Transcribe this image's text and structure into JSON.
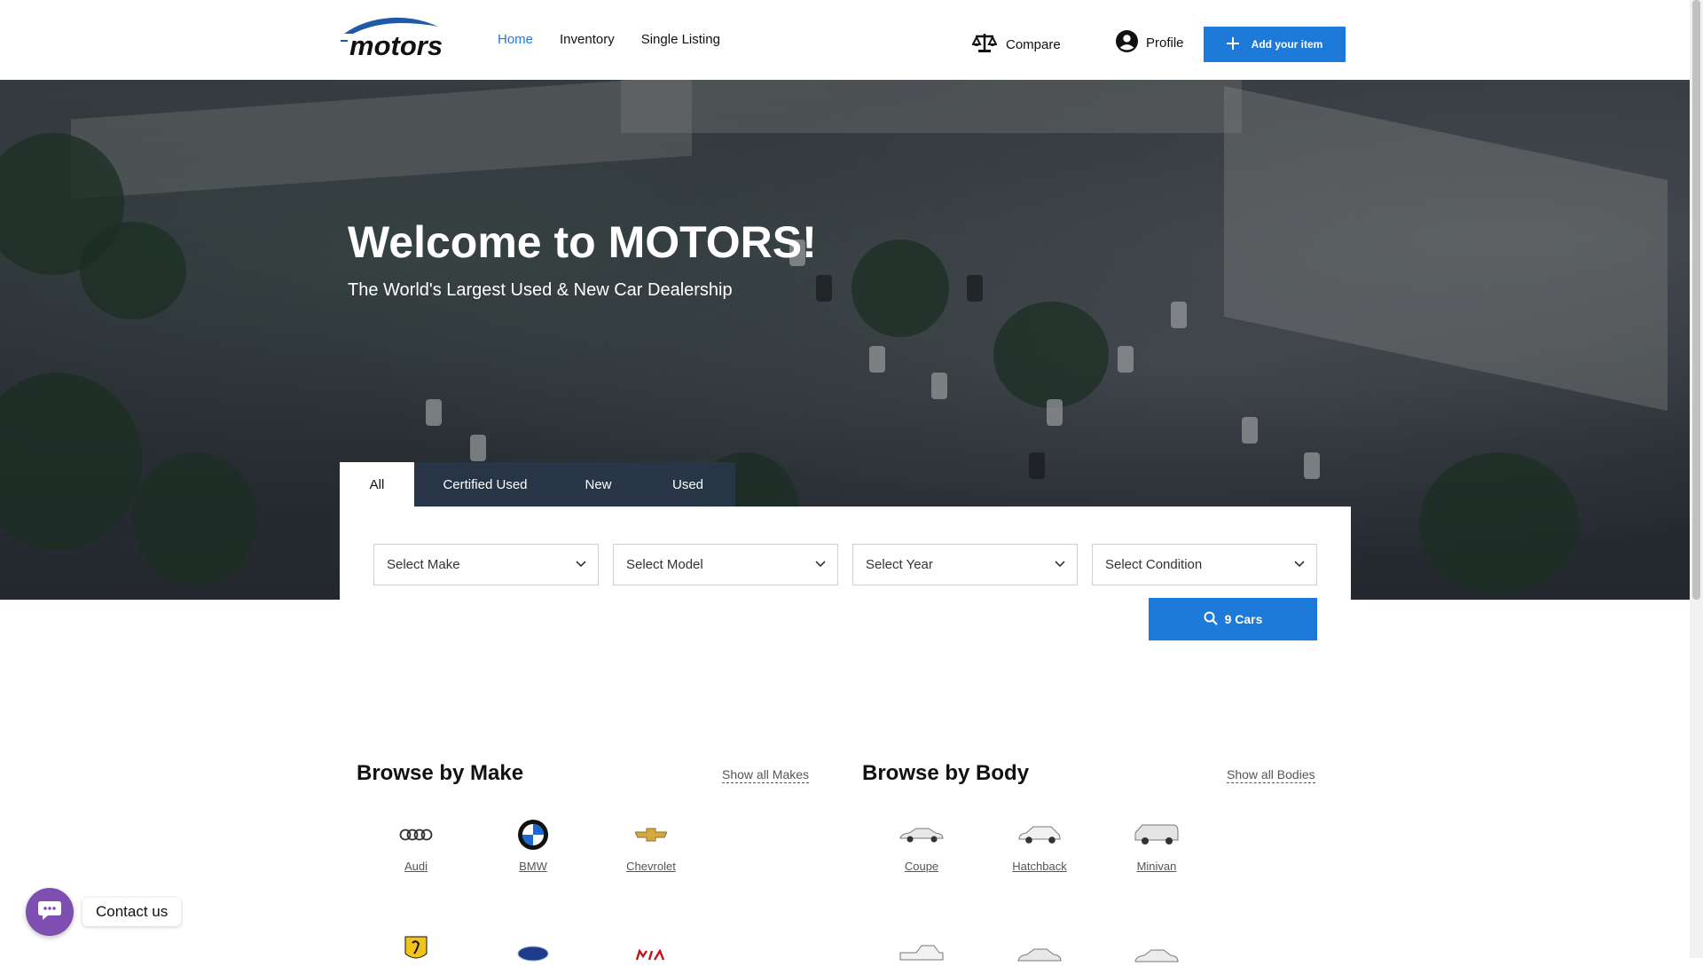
{
  "brand": {
    "logo_text": "motors"
  },
  "nav": [
    {
      "label": "Home",
      "active": true
    },
    {
      "label": "Inventory",
      "active": false
    },
    {
      "label": "Single Listing",
      "active": false
    }
  ],
  "header": {
    "compare_label": "Compare",
    "profile_label": "Profile",
    "add_item_label": "Add your item"
  },
  "hero": {
    "title": "Welcome to MOTORS!",
    "subtitle": "The World's Largest Used & New Car Dealership"
  },
  "search": {
    "tabs": [
      "All",
      "Certified Used",
      "New",
      "Used"
    ],
    "active_tab": "All",
    "selects": [
      "Select Make",
      "Select Model",
      "Select Year",
      "Select Condition"
    ],
    "button_label": "9 Cars"
  },
  "browse_make": {
    "title": "Browse by Make",
    "link": "Show all Makes",
    "items": [
      "Audi",
      "BMW",
      "Chevrolet"
    ]
  },
  "browse_body": {
    "title": "Browse by Body",
    "link": "Show all Bodies",
    "items": [
      "Coupe",
      "Hatchback",
      "Minivan"
    ]
  },
  "contact": {
    "label": "Contact us"
  },
  "colors": {
    "accent": "#1e7ad8",
    "contact": "#7e4fb0"
  }
}
